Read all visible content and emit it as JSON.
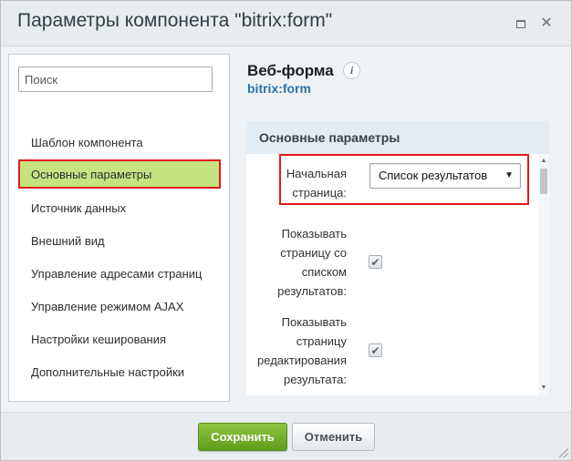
{
  "window": {
    "title": "Параметры компонента \"bitrix:form\"",
    "maximize_icon": "maximize-icon",
    "close_icon": "close-icon",
    "close_glyph": "✕"
  },
  "sidebar": {
    "search_placeholder": "Поиск",
    "items": [
      {
        "label": "Шаблон компонента",
        "active": false
      },
      {
        "label": "Основные параметры",
        "active": true
      },
      {
        "label": "Источник данных",
        "active": false
      },
      {
        "label": "Внешний вид",
        "active": false
      },
      {
        "label": "Управление адресами страниц",
        "active": false
      },
      {
        "label": "Управление режимом AJAX",
        "active": false
      },
      {
        "label": "Настройки кеширования",
        "active": false
      },
      {
        "label": "Дополнительные настройки",
        "active": false
      }
    ]
  },
  "component": {
    "title": "Веб-форма",
    "info_glyph": "i",
    "subtitle": "bitrix:form"
  },
  "section": {
    "title": "Основные параметры",
    "fields": [
      {
        "label_lines": [
          "Начальная",
          "страница:"
        ],
        "type": "select",
        "value": "Список результатов",
        "arrow_glyph": "▼"
      },
      {
        "label_lines": [
          "Показывать",
          "страницу со",
          "списком",
          "результатов:"
        ],
        "type": "checkbox",
        "checked": true
      },
      {
        "label_lines": [
          "Показывать",
          "страницу",
          "редактирования",
          "результата:"
        ],
        "type": "checkbox",
        "checked": true
      }
    ],
    "checkmark_glyph": "✔"
  },
  "scrollbar": {
    "up_glyph": "▲",
    "down_glyph": "▼"
  },
  "footer": {
    "save_label": "Сохранить",
    "cancel_label": "Отменить"
  },
  "colors": {
    "active_nav_bg": "#c6e37f",
    "highlight_border": "#e0191b",
    "save_button": "#6fae2a",
    "link_blue": "#2f73a8"
  }
}
